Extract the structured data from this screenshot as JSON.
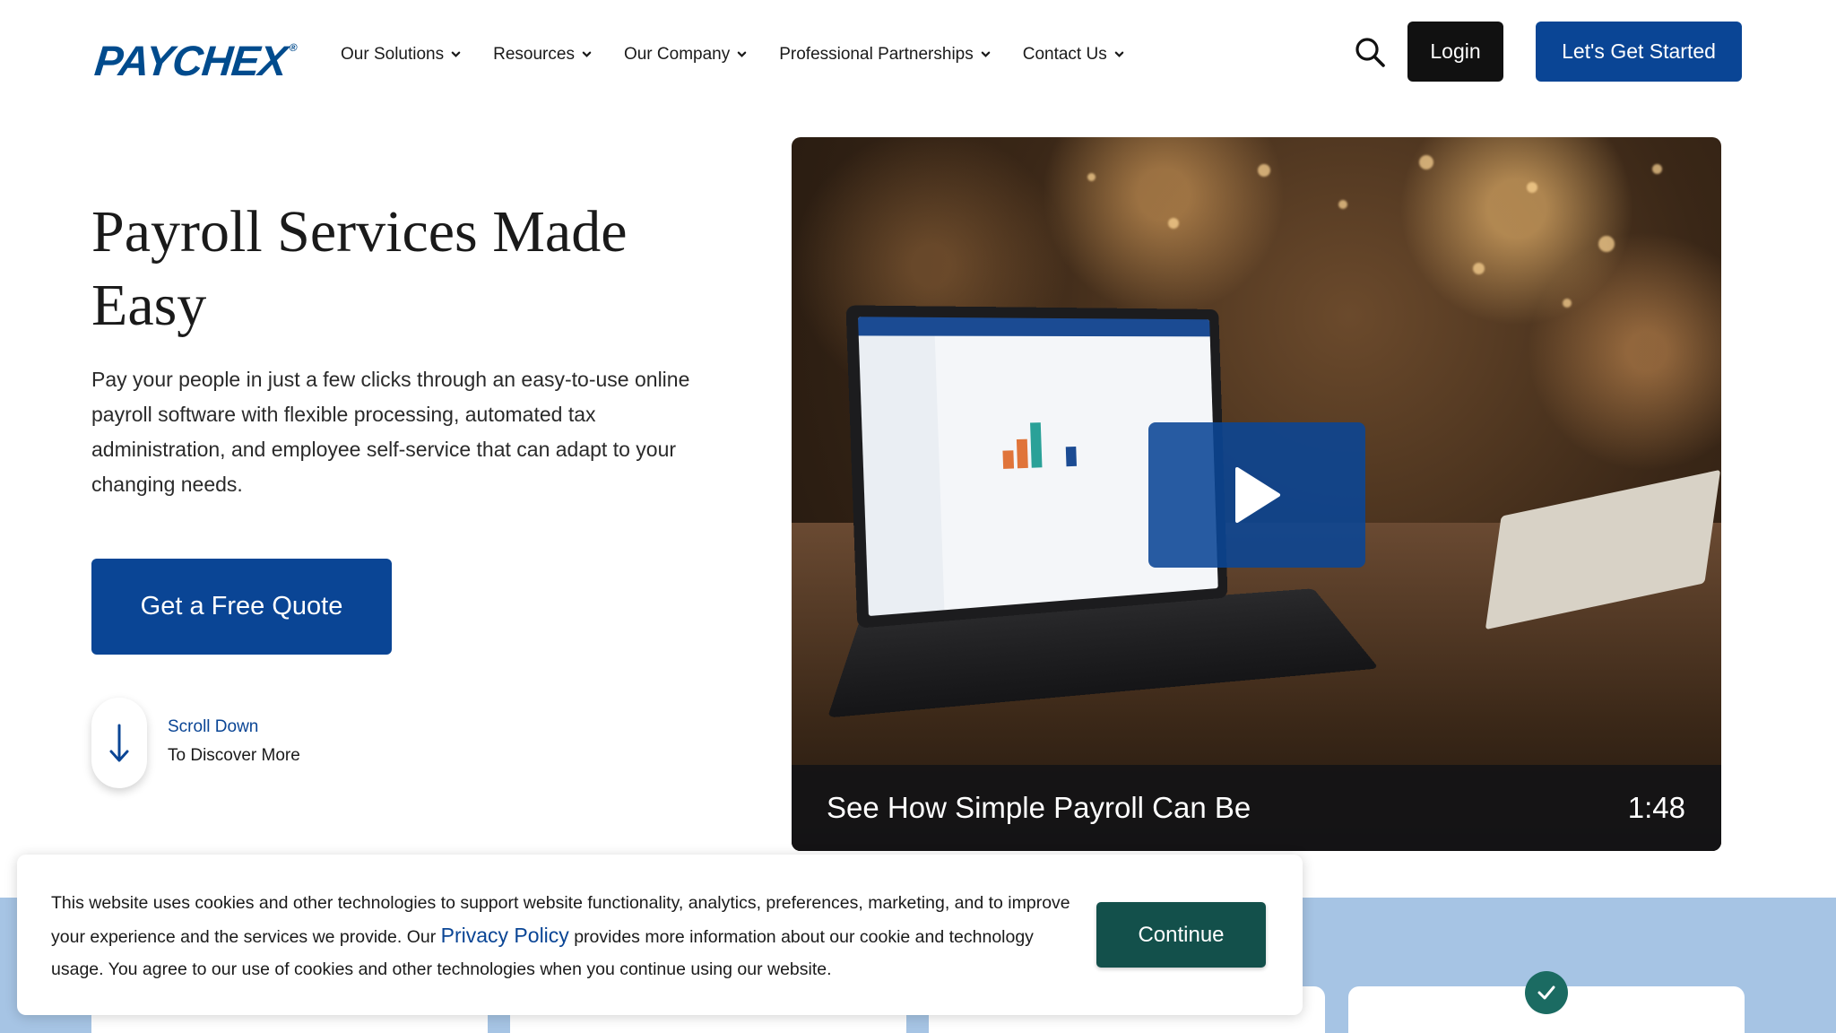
{
  "brand": {
    "logo_text": "PAYCHEX",
    "logo_mark": "®",
    "primary_color": "#0a4595",
    "cookie_button_color": "#13504b",
    "band_color": "#a6c4e4"
  },
  "nav": {
    "items": [
      {
        "label": "Our Solutions",
        "icon": "chevron-down-icon"
      },
      {
        "label": "Resources",
        "icon": "chevron-down-icon"
      },
      {
        "label": "Our Company",
        "icon": "chevron-down-icon"
      },
      {
        "label": "Professional Partnerships",
        "icon": "chevron-down-icon"
      },
      {
        "label": "Contact Us",
        "icon": "chevron-down-icon"
      }
    ],
    "search_icon": "search-icon",
    "login_label": "Login",
    "cta_label": "Let's Get Started"
  },
  "hero": {
    "title": "Payroll Services Made Easy",
    "description": "Pay your people in just a few clicks through an easy-to-use online payroll software with flexible processing, automated tax administration, and employee self-service that can adapt to your changing needs.",
    "quote_label": "Get a Free Quote",
    "scroll_line1": "Scroll Down",
    "scroll_line2": "To Discover More",
    "scroll_icon": "arrow-down-icon"
  },
  "video": {
    "caption": "See How Simple Payroll Can Be",
    "duration": "1:48",
    "play_icon": "play-icon"
  },
  "cookie": {
    "text_before": "This website uses cookies and other technologies to support website functionality, analytics, preferences, marketing, and to improve your experience and the services we provide. Our ",
    "link_label": "Privacy Policy",
    "text_after": " provides more information about our cookie and technology usage. You agree to our use of cookies and other technologies when you continue using our website.",
    "button_label": "Continue"
  },
  "badge_icon": "checkmark-icon"
}
